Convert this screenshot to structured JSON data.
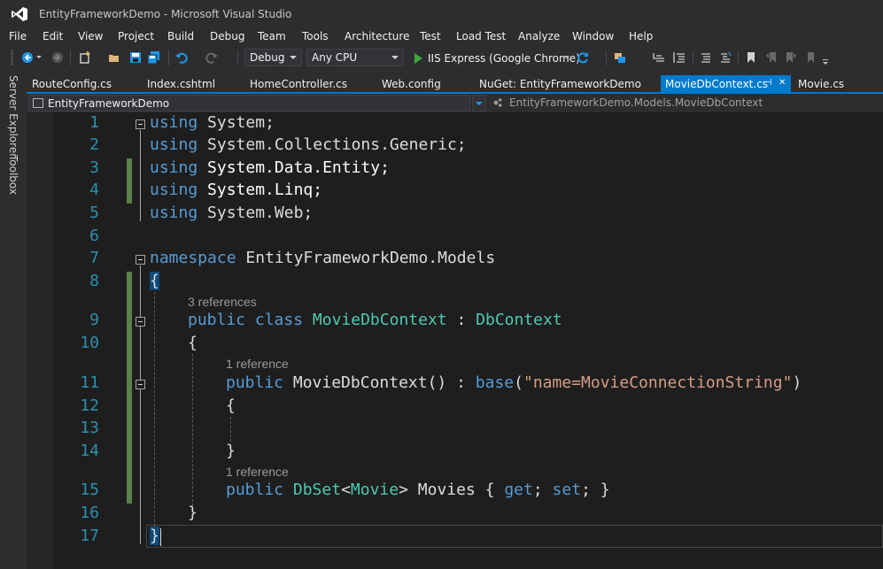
{
  "window": {
    "title": "EntityFrameworkDemo - Microsoft Visual Studio"
  },
  "menu": [
    "File",
    "Edit",
    "View",
    "Project",
    "Build",
    "Debug",
    "Team",
    "Tools",
    "Architecture",
    "Test",
    "Load Test",
    "Analyze",
    "Window",
    "Help"
  ],
  "toolbar": {
    "configuration": "Debug",
    "platform": "Any CPU",
    "run_target": "IIS Express (Google Chrome)"
  },
  "side_panels": [
    "Server Explorer",
    "Toolbox"
  ],
  "tabs": [
    {
      "label": "RouteConfig.cs",
      "active": false
    },
    {
      "label": "Index.cshtml",
      "active": false
    },
    {
      "label": "HomeController.cs",
      "active": false
    },
    {
      "label": "Web.config",
      "active": false
    },
    {
      "label": "NuGet: EntityFrameworkDemo",
      "active": false
    },
    {
      "label": "MovieDbContext.cs",
      "active": true,
      "pin": "⊣",
      "close": "✕"
    },
    {
      "label": "Movie.cs",
      "active": false
    }
  ],
  "nav": {
    "project": "EntityFrameworkDemo",
    "class_path": "EntityFrameworkDemo.Models.MovieDbContext"
  },
  "editor": {
    "line_numbers": [
      "1",
      "2",
      "3",
      "4",
      "5",
      "6",
      "7",
      "8",
      "9",
      "10",
      "11",
      "12",
      "13",
      "14",
      "15",
      "16",
      "17"
    ],
    "lenses": {
      "class_refs": "3 references",
      "ctor_refs": "1 reference",
      "dbset_refs": "1 reference"
    },
    "code": {
      "using": "using",
      "ns1": "System",
      "ns2": "System.Collections.Generic",
      "ns3": "System.Data.Entity",
      "ns4": "System.Linq",
      "ns5": "System.Web",
      "semicolon": ";",
      "namespace_kw": "namespace",
      "namespace_name": "EntityFrameworkDemo.Models",
      "open_brace": "{",
      "close_brace": "}",
      "public_kw": "public",
      "class_kw": "class",
      "class_name": "MovieDbContext",
      "colon": ":",
      "base_type": "DbContext",
      "ctor_name": "MovieDbContext()",
      "base_kw": "base",
      "paren_open": "(",
      "ctor_arg": "\"name=MovieConnectionString\"",
      "paren_close": ")",
      "dbset_type": "DbSet",
      "lt": "<",
      "entity_type": "Movie",
      "gt": ">",
      "prop_name": "Movies",
      "get_kw": "get",
      "set_kw": "set",
      "accessor_open": "{",
      "accessor_close": "}"
    }
  },
  "colors": {
    "keyword": "#569cd6",
    "type": "#4ec9b0",
    "string": "#d69d85",
    "line_number": "#2b91af",
    "accent": "#007acc",
    "change_bar": "#57824a"
  }
}
